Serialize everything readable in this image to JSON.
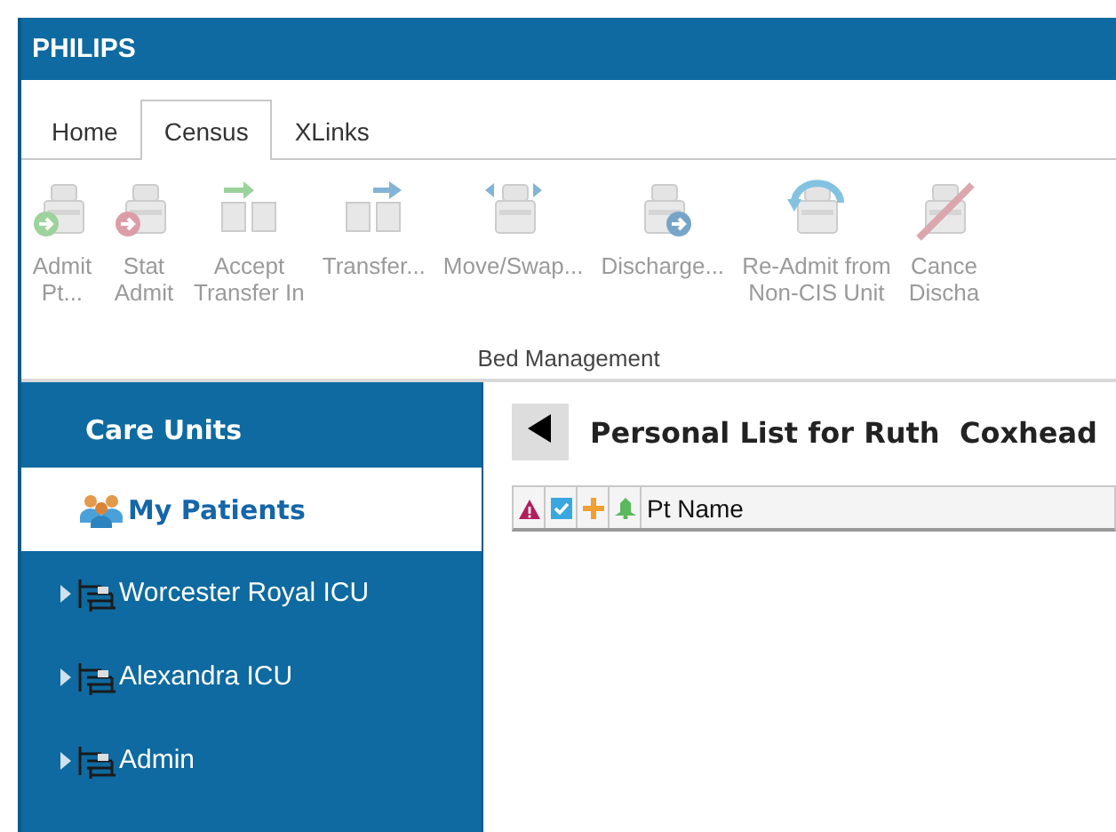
{
  "window": {
    "title": "PHILIPS"
  },
  "tabs": [
    {
      "label": "Home",
      "selected": false
    },
    {
      "label": "Census",
      "selected": true
    },
    {
      "label": "XLinks",
      "selected": false
    }
  ],
  "ribbon": {
    "group": "Bed Management",
    "buttons": [
      {
        "lines": [
          "Admit",
          "Pt..."
        ],
        "disabled": true
      },
      {
        "lines": [
          "Stat",
          "Admit"
        ],
        "disabled": true
      },
      {
        "lines": [
          "Accept",
          "Transfer In"
        ],
        "disabled": true
      },
      {
        "lines": [
          "Transfer..."
        ],
        "disabled": true
      },
      {
        "lines": [
          "Move/Swap..."
        ],
        "disabled": true
      },
      {
        "lines": [
          "Discharge..."
        ],
        "disabled": true
      },
      {
        "lines": [
          "Re-Admit from",
          "Non-CIS Unit"
        ],
        "disabled": true
      },
      {
        "lines": [
          "Cance",
          "Discha"
        ],
        "disabled": true
      }
    ]
  },
  "sidebar": {
    "header": "Care Units",
    "items": [
      {
        "kind": "list",
        "label": "My Patients",
        "selected": true
      },
      {
        "kind": "unit",
        "label": "Worcester Royal ICU",
        "selected": false,
        "expanded": false
      },
      {
        "kind": "unit",
        "label": "Alexandra ICU",
        "selected": false,
        "expanded": false
      },
      {
        "kind": "unit",
        "label": "Admin",
        "selected": false,
        "expanded": false
      }
    ]
  },
  "main": {
    "title": "Personal List for Ruth  Coxhead",
    "columns": [
      {
        "kind": "alert"
      },
      {
        "kind": "check"
      },
      {
        "kind": "cross"
      },
      {
        "kind": "bell"
      },
      {
        "kind": "text",
        "label": "Pt Name"
      }
    ]
  }
}
